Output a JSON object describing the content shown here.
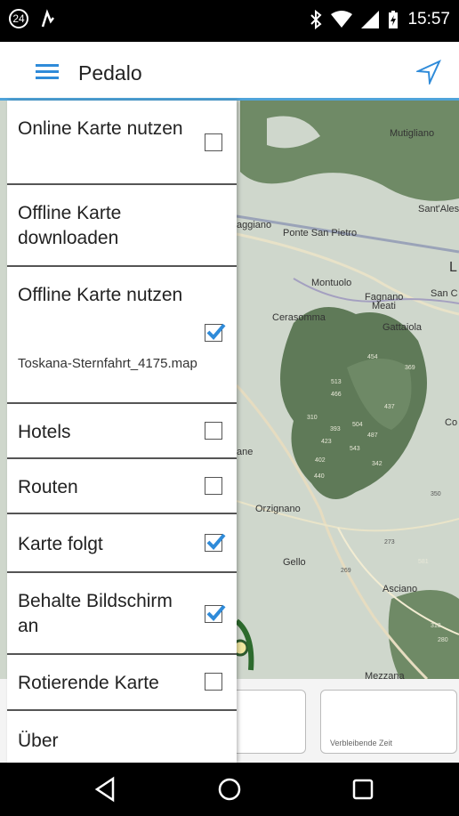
{
  "status": {
    "badge": "24",
    "time": "15:57"
  },
  "app": {
    "title": "Pedalo"
  },
  "drawer": {
    "online_map": {
      "label": "Online Karte nutzen",
      "checked": false
    },
    "offline_download": {
      "label": "Offline Karte downloaden"
    },
    "offline_map": {
      "label": "Offline Karte nutzen",
      "checked": true,
      "file": "Toskana-Sternfahrt_4175.map"
    },
    "hotels": {
      "label": "Hotels",
      "checked": false
    },
    "routes": {
      "label": "Routen",
      "checked": false
    },
    "follow": {
      "label": "Karte folgt",
      "checked": true
    },
    "screen_on": {
      "label": "Behalte Bildschirm an",
      "checked": true
    },
    "rotate": {
      "label": "Rotierende Karte",
      "checked": false
    },
    "about": {
      "label": "Über"
    }
  },
  "map": {
    "places": [
      "Mutigliano",
      "Sant'Ales",
      "aggiano",
      "Ponte San Pietro",
      "L",
      "Montuolo",
      "San C",
      "Fagnano",
      "Meati",
      "Cerasomma",
      "Gattaiola",
      "ane",
      "Orzignano",
      "Co",
      "Gello",
      "Asciano",
      "Mezzana"
    ],
    "elevations": [
      "454",
      "369",
      "513",
      "466",
      "437",
      "310",
      "393",
      "504",
      "487",
      "423",
      "543",
      "402",
      "342",
      "440",
      "350",
      "273",
      "269",
      "581",
      "313",
      "280"
    ]
  },
  "info": {
    "remaining_time_label": "Verbleibende Zeit"
  },
  "colors": {
    "accent": "#4fa3d9",
    "checkbox": "#2f8bd9",
    "forest": "#5f7a58",
    "map_bg": "#cfd7cc"
  }
}
